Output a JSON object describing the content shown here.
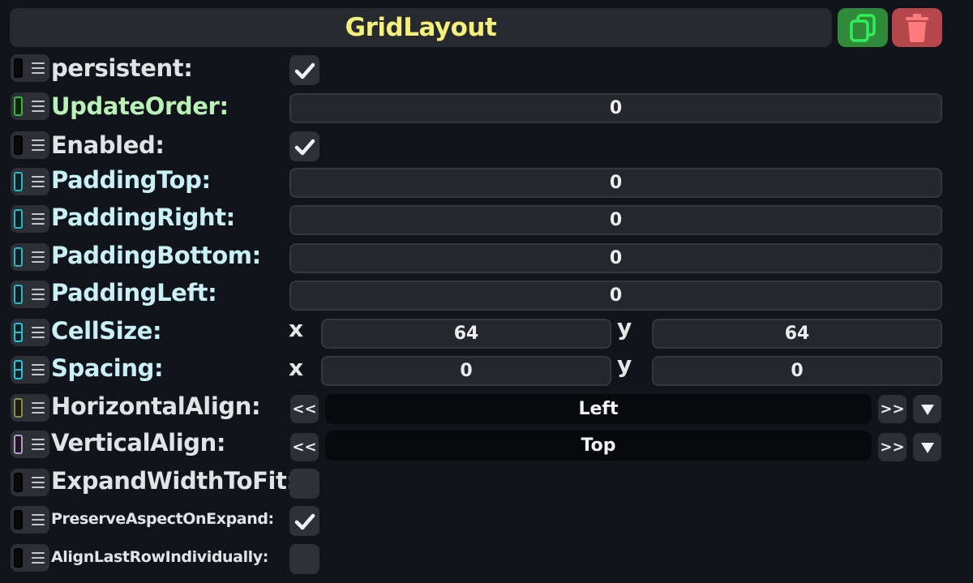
{
  "header": {
    "title": "GridLayout",
    "duplicate_icon": "copy-icon",
    "delete_icon": "trash-icon"
  },
  "colors": {
    "title": "#f4f07a",
    "duplicate_button": "#2f8a3a",
    "delete_button": "#b5474c",
    "background": "#11141b"
  },
  "fields": {
    "persistent": {
      "label": "persistent:",
      "checked": true
    },
    "update_order": {
      "label": "UpdateOrder:",
      "value": "0"
    },
    "enabled": {
      "label": "Enabled:",
      "checked": true
    },
    "padding_top": {
      "label": "PaddingTop:",
      "value": "0"
    },
    "padding_right": {
      "label": "PaddingRight:",
      "value": "0"
    },
    "padding_bottom": {
      "label": "PaddingBottom:",
      "value": "0"
    },
    "padding_left": {
      "label": "PaddingLeft:",
      "value": "0"
    },
    "cell_size": {
      "label": "CellSize:",
      "x_label": "x",
      "y_label": "y",
      "x": "64",
      "y": "64"
    },
    "spacing": {
      "label": "Spacing:",
      "x_label": "x",
      "y_label": "y",
      "x": "0",
      "y": "0"
    },
    "horizontal_align": {
      "label": "HorizontalAlign:",
      "value": "Left",
      "prev": "<<",
      "next": ">>"
    },
    "vertical_align": {
      "label": "VerticalAlign:",
      "value": "Top",
      "prev": "<<",
      "next": ">>"
    },
    "expand_width_to_fit": {
      "label": "ExpandWidthToFit:",
      "checked": false
    },
    "preserve_aspect_on_expand": {
      "label": "PreserveAspectOnExpand:",
      "checked": true
    },
    "align_last_row_individually": {
      "label": "AlignLastRowIndividually:",
      "checked": false
    }
  }
}
